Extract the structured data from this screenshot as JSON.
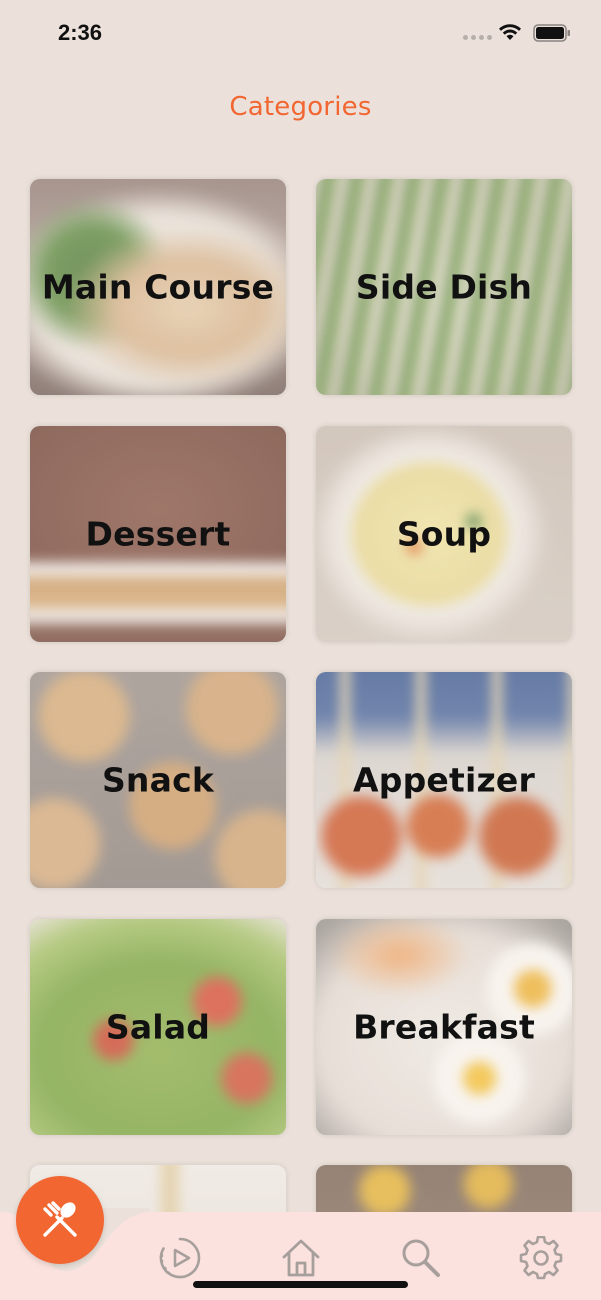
{
  "status_bar": {
    "time": "2:36"
  },
  "header": {
    "title": "Categories"
  },
  "categories": [
    {
      "label": "Main Course"
    },
    {
      "label": "Side Dish"
    },
    {
      "label": "Dessert"
    },
    {
      "label": "Soup"
    },
    {
      "label": "Snack"
    },
    {
      "label": "Appetizer"
    },
    {
      "label": "Salad"
    },
    {
      "label": "Breakfast"
    }
  ],
  "tab_bar": {
    "fab_icon": "fork-spoon-icon",
    "tabs": [
      {
        "icon": "play-circle-icon"
      },
      {
        "icon": "home-icon"
      },
      {
        "icon": "search-icon"
      },
      {
        "icon": "gear-icon"
      }
    ]
  },
  "colors": {
    "accent": "#f26632",
    "background": "#ebe1da",
    "tab_bar": "#fbe2df",
    "tab_icon": "#a79f9b"
  }
}
